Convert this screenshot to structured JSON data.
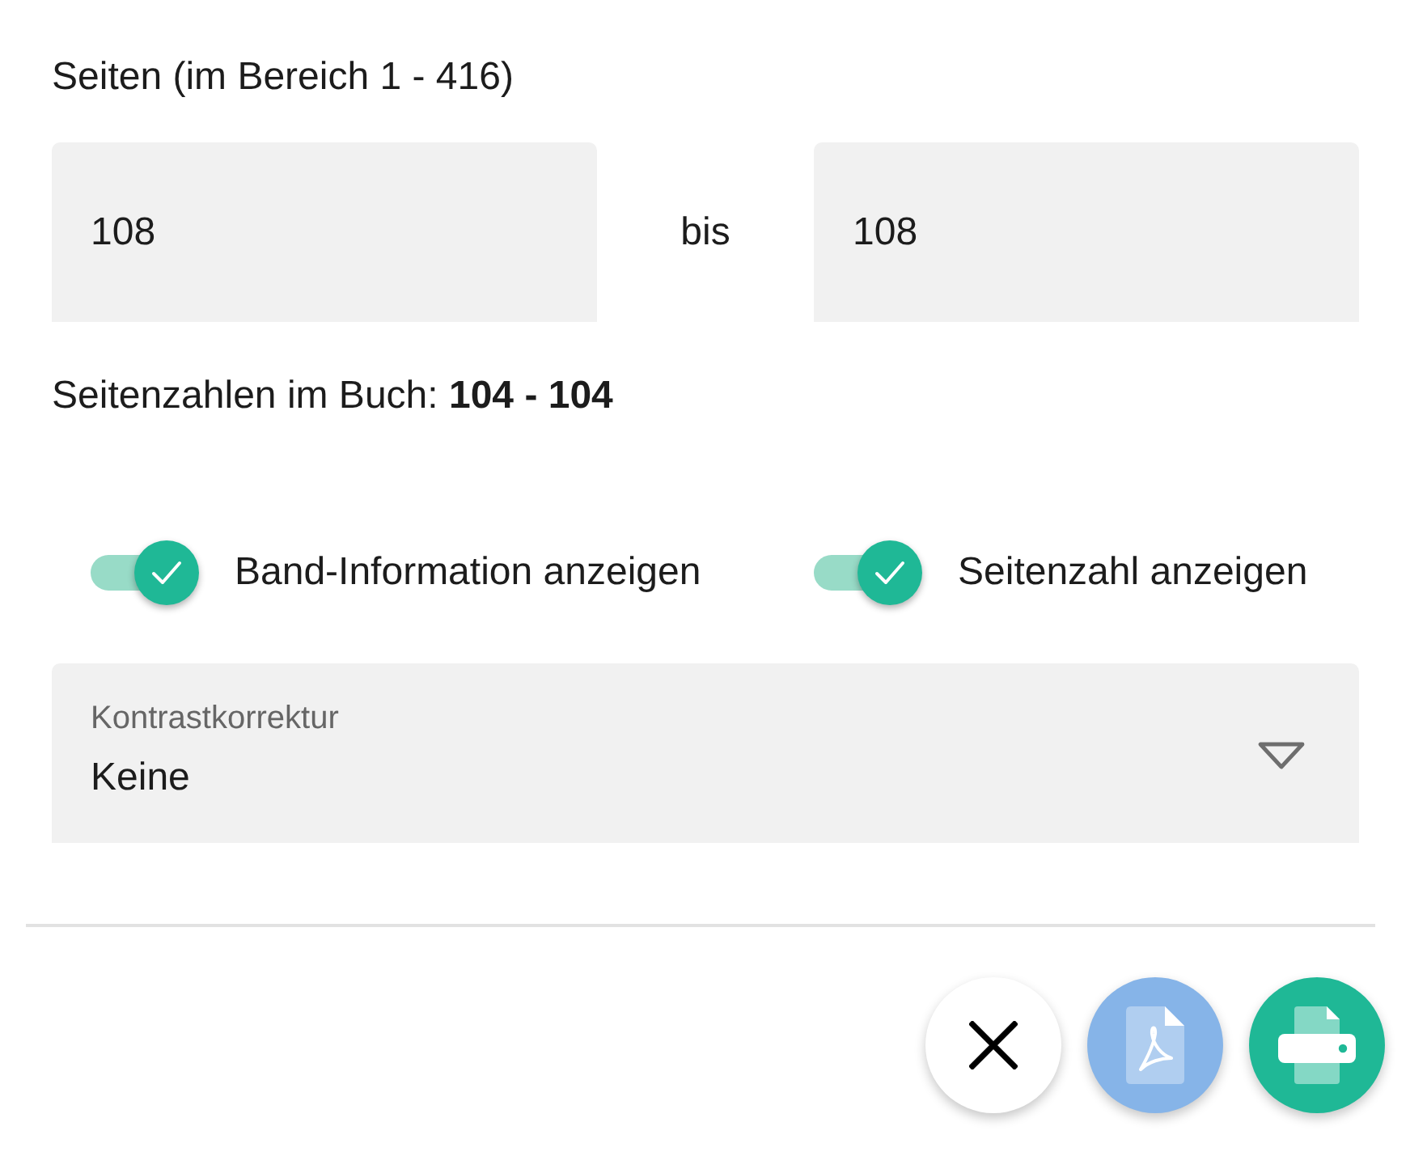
{
  "range_label": "Seiten (im Bereich 1 - 416)",
  "page_range": {
    "from": {
      "value": "108"
    },
    "separator": "bis",
    "to": {
      "value": "108"
    }
  },
  "book_pages": "Seitenzahlen im Buch: **104 - 104**",
  "toggles": [
    {
      "label": "Band-Information anzeigen",
      "on": true
    },
    {
      "label": "Seitenzahl anzeigen",
      "on": true
    }
  ],
  "select": {
    "label": "Kontrastkorrektur",
    "value": "Keine"
  },
  "buttons": [
    {
      "kind": "close"
    },
    {
      "kind": "pdf"
    },
    {
      "kind": "print"
    }
  ]
}
